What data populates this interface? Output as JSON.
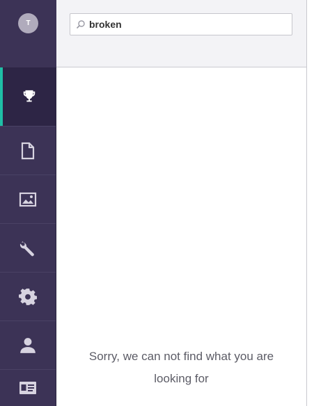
{
  "user": {
    "avatar_initial": "T"
  },
  "sidebar": {
    "items": [
      {
        "icon": "trophy-icon",
        "active": true
      },
      {
        "icon": "document-icon",
        "active": false
      },
      {
        "icon": "image-icon",
        "active": false
      },
      {
        "icon": "wrench-icon",
        "active": false
      },
      {
        "icon": "gear-icon",
        "active": false
      },
      {
        "icon": "user-icon",
        "active": false
      },
      {
        "icon": "id-card-icon",
        "active": false
      }
    ]
  },
  "search": {
    "value": "broken",
    "placeholder": ""
  },
  "main": {
    "empty_message": "Sorry, we can not find what you are looking for"
  },
  "colors": {
    "sidebar_bg": "#3c3356",
    "sidebar_active_bg": "#2d2545",
    "accent": "#1fbfa6",
    "icon": "#d7d3e0"
  }
}
